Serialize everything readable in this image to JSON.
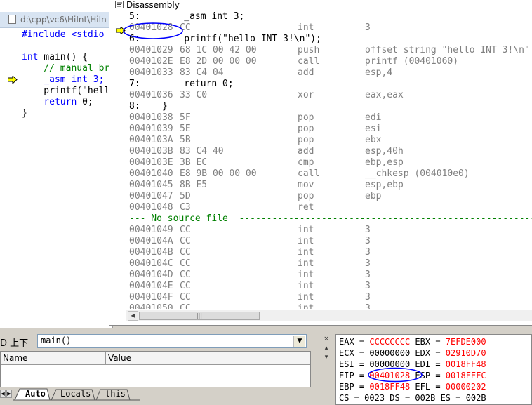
{
  "source_window": {
    "title": "d:\\cpp\\vc6\\HiInt\\HiIn",
    "lines": [
      {
        "segments": [
          {
            "t": "#include <stdio",
            "c": "kw"
          }
        ]
      },
      {
        "segments": []
      },
      {
        "segments": [
          {
            "t": "int",
            "c": "kw"
          },
          {
            "t": " main() {",
            "c": ""
          }
        ]
      },
      {
        "segments": [
          {
            "t": "    // manual br",
            "c": "cm"
          }
        ]
      },
      {
        "segments": [
          {
            "t": "    _asm int 3;",
            "c": "kw"
          }
        ]
      },
      {
        "segments": [
          {
            "t": "    printf(\"hell",
            "c": ""
          }
        ]
      },
      {
        "segments": [
          {
            "t": "    ",
            "c": ""
          },
          {
            "t": "return",
            "c": "kw"
          },
          {
            "t": " 0;",
            "c": ""
          }
        ]
      },
      {
        "segments": [
          {
            "t": "}",
            "c": ""
          }
        ]
      }
    ]
  },
  "disassembly": {
    "title": "Disassembly",
    "lines": [
      {
        "kind": "src",
        "text": "5:        _asm int 3;"
      },
      {
        "kind": "asm",
        "addr": "00401028",
        "bytes": "CC",
        "mnem": "int",
        "ops": "3",
        "current": true
      },
      {
        "kind": "src",
        "text": "6:        printf(\"hello INT 3!\\n\");"
      },
      {
        "kind": "asm",
        "addr": "00401029",
        "bytes": "68 1C 00 42 00",
        "mnem": "push",
        "ops": "offset string \"hello INT 3!\\n\""
      },
      {
        "kind": "asm",
        "addr": "0040102E",
        "bytes": "E8 2D 00 00 00",
        "mnem": "call",
        "ops": "printf (00401060)"
      },
      {
        "kind": "asm",
        "addr": "00401033",
        "bytes": "83 C4 04",
        "mnem": "add",
        "ops": "esp,4"
      },
      {
        "kind": "src",
        "text": "7:        return 0;"
      },
      {
        "kind": "asm",
        "addr": "00401036",
        "bytes": "33 C0",
        "mnem": "xor",
        "ops": "eax,eax"
      },
      {
        "kind": "src",
        "text": "8:    }"
      },
      {
        "kind": "asm",
        "addr": "00401038",
        "bytes": "5F",
        "mnem": "pop",
        "ops": "edi"
      },
      {
        "kind": "asm",
        "addr": "00401039",
        "bytes": "5E",
        "mnem": "pop",
        "ops": "esi"
      },
      {
        "kind": "asm",
        "addr": "0040103A",
        "bytes": "5B",
        "mnem": "pop",
        "ops": "ebx"
      },
      {
        "kind": "asm",
        "addr": "0040103B",
        "bytes": "83 C4 40",
        "mnem": "add",
        "ops": "esp,40h"
      },
      {
        "kind": "asm",
        "addr": "0040103E",
        "bytes": "3B EC",
        "mnem": "cmp",
        "ops": "ebp,esp"
      },
      {
        "kind": "asm",
        "addr": "00401040",
        "bytes": "E8 9B 00 00 00",
        "mnem": "call",
        "ops": "__chkesp (004010e0)"
      },
      {
        "kind": "asm",
        "addr": "00401045",
        "bytes": "8B E5",
        "mnem": "mov",
        "ops": "esp,ebp"
      },
      {
        "kind": "asm",
        "addr": "00401047",
        "bytes": "5D",
        "mnem": "pop",
        "ops": "ebp"
      },
      {
        "kind": "asm",
        "addr": "00401048",
        "bytes": "C3",
        "mnem": "ret",
        "ops": ""
      },
      {
        "kind": "nosrc",
        "text": "--- No source file  ------------------------------------------------------------"
      },
      {
        "kind": "asm",
        "addr": "00401049",
        "bytes": "CC",
        "mnem": "int",
        "ops": "3"
      },
      {
        "kind": "asm",
        "addr": "0040104A",
        "bytes": "CC",
        "mnem": "int",
        "ops": "3"
      },
      {
        "kind": "asm",
        "addr": "0040104B",
        "bytes": "CC",
        "mnem": "int",
        "ops": "3"
      },
      {
        "kind": "asm",
        "addr": "0040104C",
        "bytes": "CC",
        "mnem": "int",
        "ops": "3"
      },
      {
        "kind": "asm",
        "addr": "0040104D",
        "bytes": "CC",
        "mnem": "int",
        "ops": "3"
      },
      {
        "kind": "asm",
        "addr": "0040104E",
        "bytes": "CC",
        "mnem": "int",
        "ops": "3"
      },
      {
        "kind": "asm",
        "addr": "0040104F",
        "bytes": "CC",
        "mnem": "int",
        "ops": "3"
      },
      {
        "kind": "asm",
        "addr": "00401050",
        "bytes": "CC",
        "mnem": "int",
        "ops": "3"
      }
    ],
    "scroll_thumb_glyph": "|||"
  },
  "variables": {
    "context_label": "D 上下",
    "context_value": "main()",
    "columns": [
      "Name",
      "Value"
    ],
    "tabs": [
      "Auto",
      "Locals",
      "this"
    ]
  },
  "registers": {
    "rows": [
      [
        {
          "n": "EAX",
          "v": "CCCCCCCC",
          "changed": true
        },
        {
          "n": "EBX",
          "v": "7EFDE000",
          "changed": true
        }
      ],
      [
        {
          "n": "ECX",
          "v": "00000000",
          "changed": false
        },
        {
          "n": "EDX",
          "v": "02910D70",
          "changed": true
        }
      ],
      [
        {
          "n": "ESI",
          "v": "00000000",
          "changed": false
        },
        {
          "n": "EDI",
          "v": "0018FF48",
          "changed": true
        }
      ],
      [
        {
          "n": "EIP",
          "v": "00401028",
          "changed": true
        },
        {
          "n": "ESP",
          "v": "0018FEFC",
          "changed": true
        }
      ],
      [
        {
          "n": "EBP",
          "v": "0018FF48",
          "changed": true
        },
        {
          "n": "EFL",
          "v": "00000202",
          "changed": true
        }
      ],
      [
        {
          "n": "CS",
          "v": "0023",
          "changed": false
        },
        {
          "n": "DS",
          "v": "002B",
          "changed": false
        },
        {
          "n": "ES",
          "v": "002B",
          "changed": false
        }
      ]
    ]
  },
  "colors": {
    "highlight_blue": "#0000ff",
    "changed_red": "#ff0000",
    "gray_text": "#808080",
    "comment_green": "#008000",
    "arrow_yellow": "#ffff00"
  }
}
